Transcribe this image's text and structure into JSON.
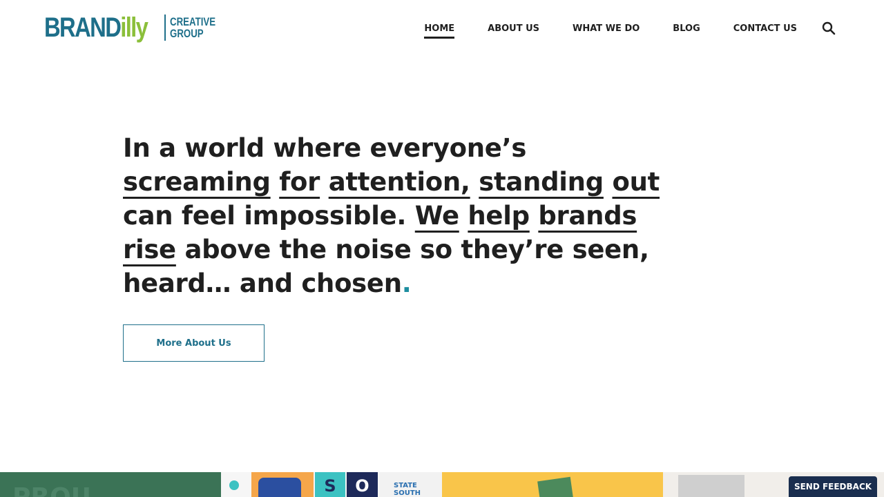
{
  "brand": {
    "logo_main": "BRAND",
    "logo_accent": "illy",
    "logo_line1": "CREATIVE",
    "logo_line2": "GROUP"
  },
  "nav": {
    "items": [
      {
        "label": "HOME",
        "active": true
      },
      {
        "label": "ABOUT US",
        "active": false
      },
      {
        "label": "WHAT WE DO",
        "active": false
      },
      {
        "label": "BLOG",
        "active": false
      },
      {
        "label": "CONTACT US",
        "active": false
      }
    ],
    "search_icon": "search-icon"
  },
  "hero": {
    "p1": "In a world where everyone’s",
    "w1": "screaming",
    "w2": "for",
    "w3": "attention,",
    "w4": "standing",
    "w5": "out",
    "p2": "can feel impossible.",
    "w6": "We",
    "w7": "help",
    "w8": "brands",
    "w9": "rise",
    "p3": "above the noise so they’re seen, heard… and chosen",
    "dot": ".",
    "cta_label": "More About Us"
  },
  "strip": {
    "tile1_text": "PROU",
    "tile2_letter1": "S",
    "tile2_letter2": "O",
    "tile2_badge": "STATE SOUTH"
  },
  "feedback_label": "SEND FEEDBACK",
  "colors": {
    "brand_teal": "#1e6f8a",
    "brand_green": "#8bbf3a",
    "text": "#1f1f1f",
    "feedback_bg": "#1a2e4f"
  }
}
